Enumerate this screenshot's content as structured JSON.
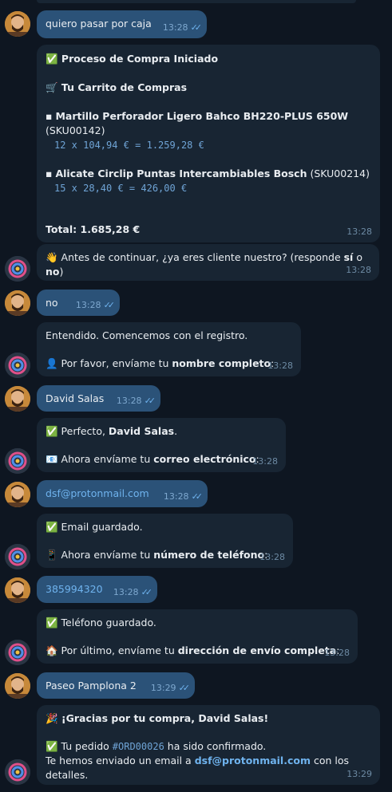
{
  "messages": {
    "m1": {
      "text": "quiero pasar por caja",
      "time": "13:28"
    },
    "m2": {
      "line1": "✅ Proceso de Compra Iniciado",
      "line2": "🛒 Tu Carrito de Compras",
      "item1_name": "Martillo Perforador Ligero Bahco BH220-PLUS 650W",
      "item1_sku": "(SKU00142)",
      "item1_calc": "12 x 104,94 € = 1.259,28 €",
      "item2_name": "Alicate Circlip Puntas Intercambiables Bosch",
      "item2_sku": "(SKU00214)",
      "item2_calc": "15 x 28,40 € = 426,00 €",
      "total": "Total: 1.685,28 €",
      "time": "13:28"
    },
    "m3": {
      "pre": "👋 Antes de continuar, ¿ya eres cliente nuestro? (responde ",
      "b1": "sí",
      "mid": " o ",
      "b2": "no",
      "post": ")",
      "time": "13:28"
    },
    "m4": {
      "text": "no",
      "time": "13:28"
    },
    "m5": {
      "line1": "Entendido. Comencemos con el registro.",
      "pre": "👤 Por favor, envíame tu ",
      "bold": "nombre completo",
      "post": ":",
      "time": "13:28"
    },
    "m6": {
      "text": "David Salas",
      "time": "13:28"
    },
    "m7": {
      "pre1": "✅ Perfecto, ",
      "bold1": "David Salas",
      "post1": ".",
      "pre2": "📧 Ahora envíame tu ",
      "bold2": "correo electrónico",
      "post2": ":",
      "time": "13:28"
    },
    "m8": {
      "text": "dsf@protonmail.com",
      "time": "13:28"
    },
    "m9": {
      "line1": "✅ Email guardado.",
      "pre": "📱 Ahora envíame tu ",
      "bold": "número de teléfono",
      "post": ":",
      "time": "13:28"
    },
    "m10": {
      "text": "385994320",
      "time": "13:28"
    },
    "m11": {
      "line1": "✅ Teléfono guardado.",
      "pre": "🏠 Por último, envíame tu ",
      "bold": "dirección de envío completa",
      "post": ":",
      "time": "13:28"
    },
    "m12": {
      "text": "Paseo Pamplona 2",
      "time": "13:29"
    },
    "m13": {
      "title": "🎉 ¡Gracias por tu compra, David Salas!",
      "pre1": "✅ Tu pedido ",
      "order": "#ORD00026",
      "post1": " ha sido confirmado.",
      "pre2": "Te hemos enviado un email a ",
      "email": "dsf@protonmail.com",
      "post2": " con los detalles.",
      "time": "13:29"
    }
  },
  "ticks": "✓✓",
  "colors": {
    "background": "#0e1621",
    "incoming": "#182533",
    "outgoing": "#2b5278",
    "link": "#6fb3ee"
  }
}
